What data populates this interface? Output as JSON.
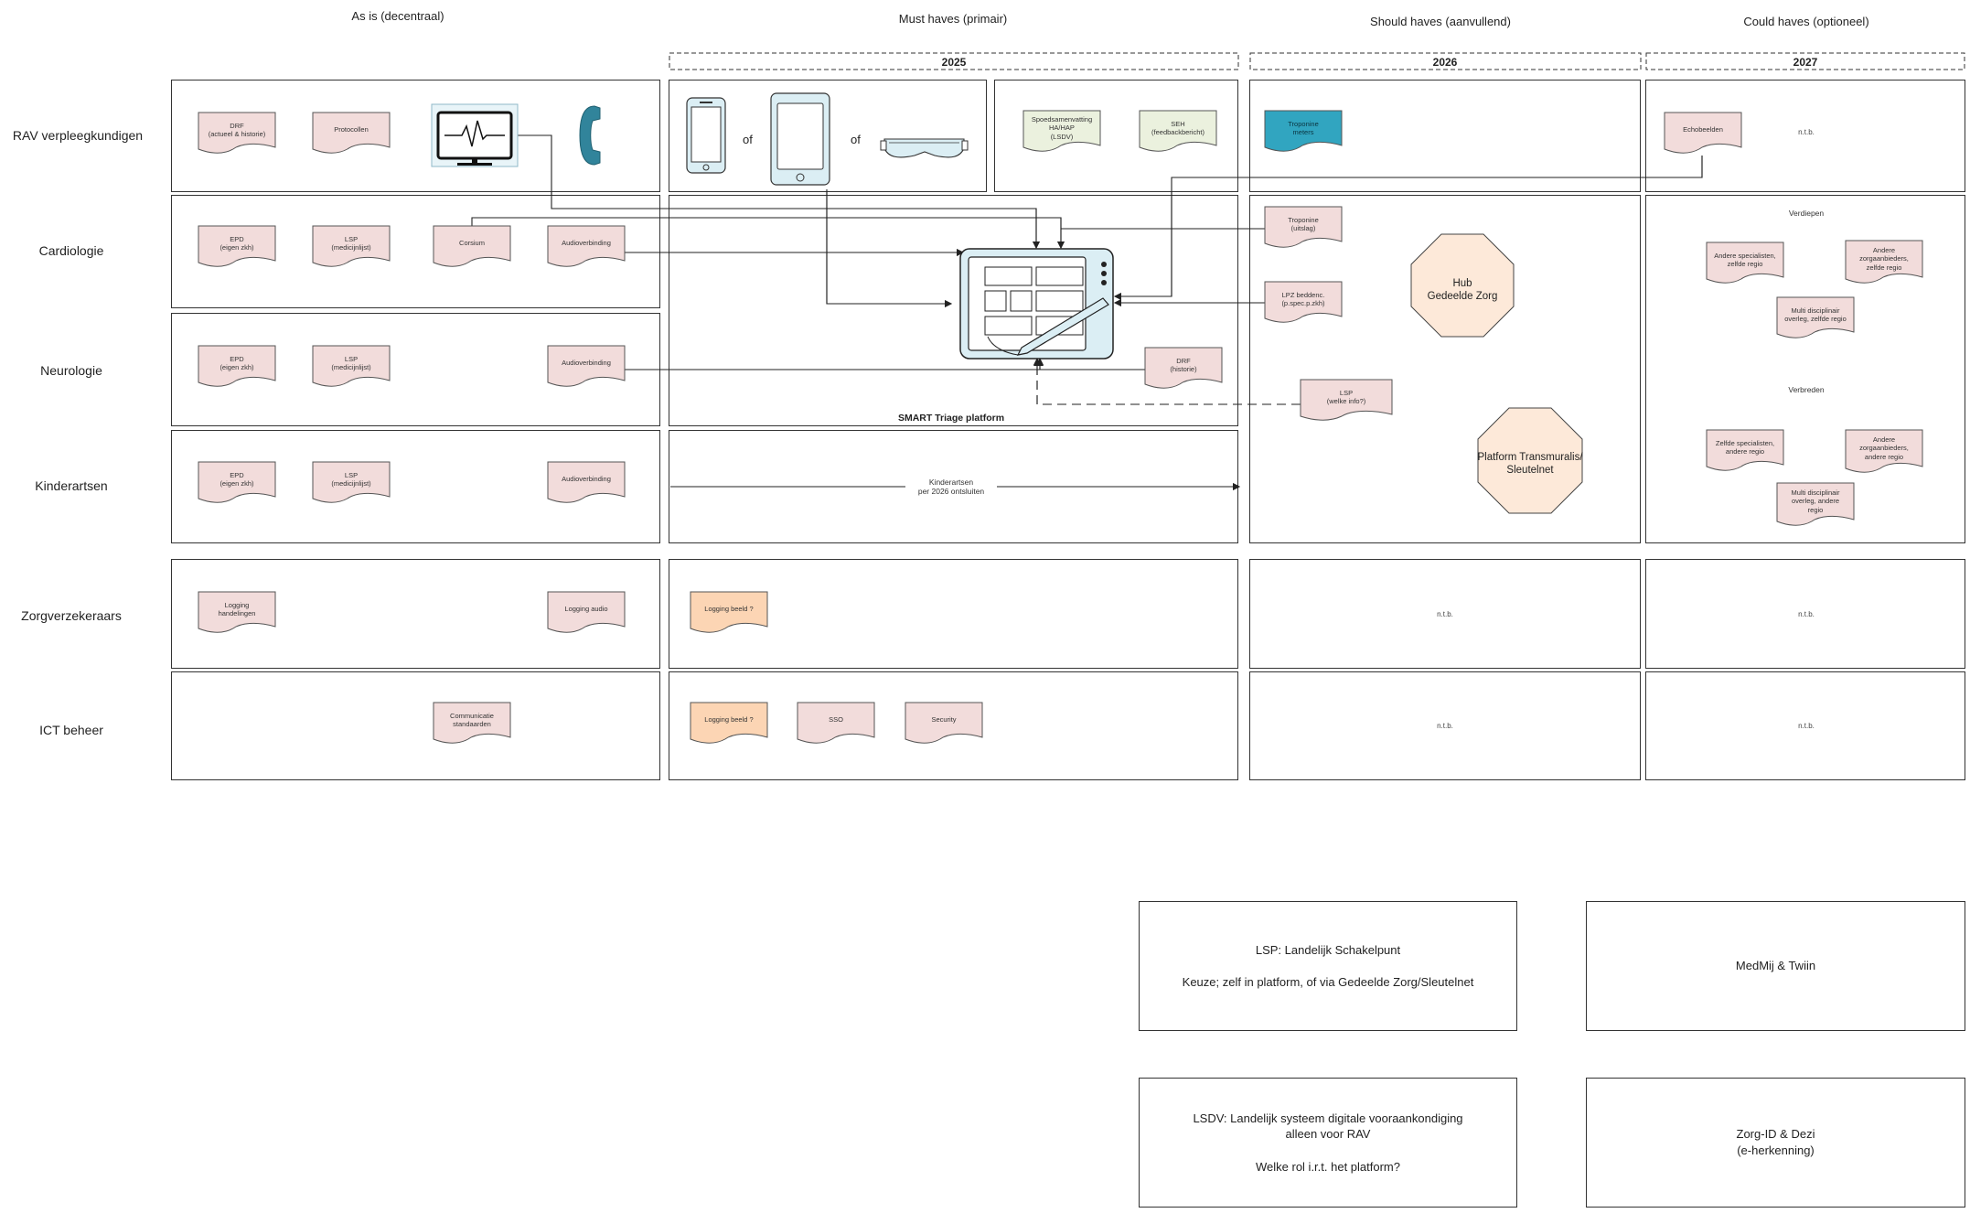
{
  "columns": {
    "as_is": "As is (decentraal)",
    "must": "Must haves (primair)",
    "should": "Should haves (aanvullend)",
    "could": "Could haves (optioneel)"
  },
  "years": {
    "y2025": "2025",
    "y2026": "2026",
    "y2027": "2027"
  },
  "rows": {
    "rav": "RAV verpleegkundigen",
    "cardio": "Cardiologie",
    "neuro": "Neurologie",
    "kinder": "Kinderartsen",
    "zorgverz": "Zorgverzekeraars",
    "ict": "ICT beheer"
  },
  "docs": {
    "drf_rav": "DRF\n(actueel & historie)",
    "protocollen": "Protocollen",
    "epd_cardio": "EPD\n(eigen zkh)",
    "lsp_cardio": "LSP\n(medicijnlijst)",
    "corsium": "Corsium",
    "audio_cardio": "Audioverbinding",
    "epd_neuro": "EPD\n(eigen zkh)",
    "lsp_neuro": "LSP\n(medicijnlijst)",
    "audio_neuro": "Audioverbinding",
    "epd_kinder": "EPD\n(eigen zkh)",
    "lsp_kinder": "LSP\n(medicijnlijst)",
    "audio_kinder": "Audioverbinding",
    "logging_hand": "Logging\nhandelingen",
    "logging_audio": "Logging audio",
    "comm_std": "Communicatie\nstandaarden",
    "spoed": "Spoedsamenvatting\nHA/HAP\n(LSDV)",
    "seh": "SEH\n(feedbackbericht)",
    "drf_hist": "DRF\n(historie)",
    "logging_beeld_zv": "Logging beeld ?",
    "logging_beeld_ict": "Logging beeld ?",
    "sso": "SSO",
    "security": "Security",
    "troponine_meters": "Troponine\nmeters",
    "troponine_uitslag": "Troponine\n(uitslag)",
    "lpz": "LPZ beddenc.\n(p.spec.p.zkh)",
    "lsp_welke": "LSP\n(welke info?)",
    "echobeelden": "Echobeelden",
    "andere_spec": "Andere specialisten,\nzelfde regio",
    "andere_zorg": "Andere\nzorgaanbieders,\nzelfde regio",
    "multi_zelfde": "Multi disciplinair\noverleg, zelfde regio",
    "zelfde_spec": "Zelfde specialisten,\nandere regio",
    "andere_zorg2": "Andere\nzorgaanbieders,\nandere regio",
    "multi_andere": "Multi disciplinair\noverleg, andere\nregio"
  },
  "labels": {
    "of1": "of",
    "of2": "of",
    "platform": "SMART Triage platform",
    "kinder_note": "Kinderartsen\nper 2026 ontsluiten",
    "verdiepen": "Verdiepen",
    "verbreden": "Verbreden",
    "ntb_rav": "n.t.b.",
    "ntb_zv_should": "n.t.b.",
    "ntb_zv_could": "n.t.b.",
    "ntb_ict_should": "n.t.b.",
    "ntb_ict_could": "n.t.b.",
    "hub": "Hub\nGedeelde Zorg",
    "transmuraal": "Platform Transmuralis/\nSleutelnet"
  },
  "legend": {
    "lsp": "LSP: Landelijk Schakelpunt\n\nKeuze; zelf in platform, of via Gedeelde Zorg/Sleutelnet",
    "medmij": "MedMij & Twiin",
    "lsdv": "LSDV: Landelijk systeem digitale vooraankondiging\nalleen voor RAV\n\nWelke rol i.r.t. het platform?",
    "zorgid": "Zorg-ID & Dezi\n(e-herkenning)"
  },
  "colors": {
    "pink": "#f2dcdb",
    "green": "#ebf1de",
    "orange": "#fcd5b4",
    "teal": "#31a5c0",
    "octagon": "#fde9d9",
    "device": "#dbeef4",
    "phone": "#31849b"
  }
}
